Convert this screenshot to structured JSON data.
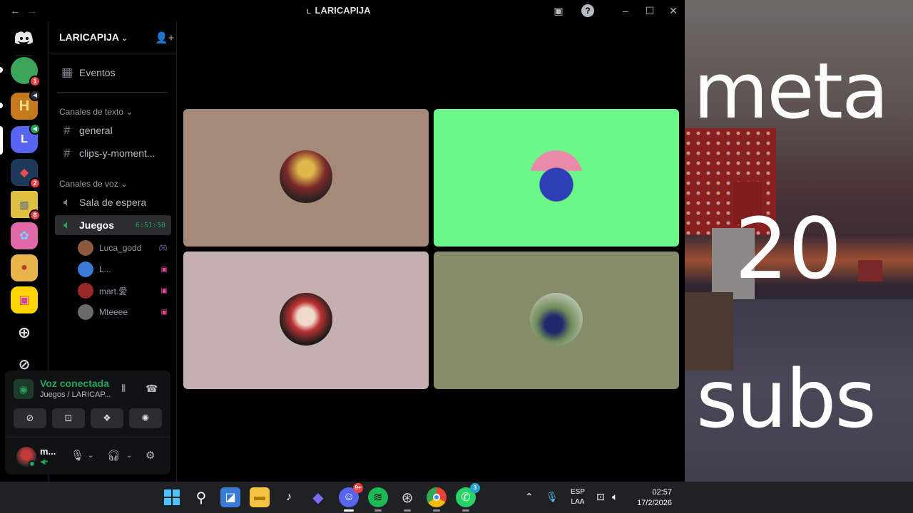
{
  "window": {
    "title": "LARICAPIJA",
    "title_prefix": "L"
  },
  "servers": [
    {
      "label": "",
      "color": "#3ba55c",
      "badge": "1"
    },
    {
      "label": "",
      "color": "#c47a1c",
      "badge": ""
    },
    {
      "label": "L",
      "color": "#5865f2",
      "badge": ""
    },
    {
      "label": "",
      "color": "#1e3a5a",
      "badge": "2"
    },
    {
      "label": "",
      "color": "#e0c040",
      "badge": "8"
    },
    {
      "label": "",
      "color": "#e06aa8",
      "badge": ""
    },
    {
      "label": "",
      "color": "#e7b54a",
      "badge": ""
    },
    {
      "label": "",
      "color": "#d43fa2",
      "badge": ""
    }
  ],
  "sidebar": {
    "server_name": "LARICAPIJA",
    "events_label": "Eventos",
    "text_category": "Canales de texto",
    "text_channels": [
      "general",
      "clips-y-moment..."
    ],
    "voice_category": "Canales de voz",
    "voice_channels": [
      {
        "name": "Sala de espera",
        "timer": ""
      },
      {
        "name": "Juegos",
        "timer": "6:51:50"
      }
    ],
    "voice_users": [
      {
        "name": "Luca_godd",
        "color": "#8b5a3c"
      },
      {
        "name": "L...",
        "color": "#3a7bd5"
      },
      {
        "name": "mart.愛",
        "color": "#9a2a2a"
      },
      {
        "name": "Mteeee",
        "color": "#6a6a6a"
      }
    ]
  },
  "voice_panel": {
    "status": "Voz conectada",
    "location": "Juegos / LARICAP...",
    "user_name": "m...",
    "user_status": "•"
  },
  "tiles": [
    {
      "bg": "#a68a78",
      "avatar": "#6a2a2a"
    },
    {
      "bg": "#6bf78a",
      "avatar": "#2e3fb5"
    },
    {
      "bg": "#c4b0b0",
      "avatar": "#b33"
    },
    {
      "bg": "#868b6a",
      "avatar": "#6f8b5a"
    }
  ],
  "overlay": {
    "line1": "meta",
    "line2": "20",
    "line3": "subs"
  },
  "taskbar": {
    "discord_badge": "9+",
    "whatsapp_badge": "3",
    "lang1": "ESP",
    "lang2": "LAA",
    "time": "02:57",
    "date": "17/2/2026"
  }
}
